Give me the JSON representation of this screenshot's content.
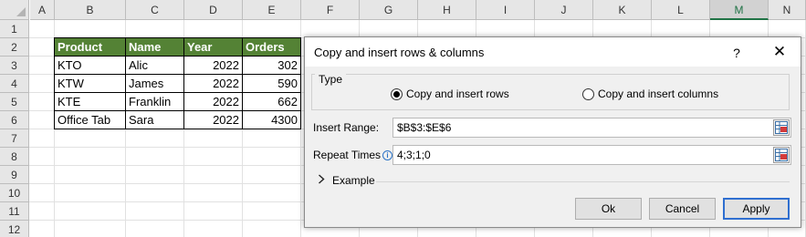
{
  "sheet": {
    "columns": [
      "A",
      "B",
      "C",
      "D",
      "E",
      "F",
      "G",
      "H",
      "I",
      "J",
      "K",
      "L",
      "M",
      "N"
    ],
    "selected_column": "M",
    "rows": [
      "1",
      "2",
      "3",
      "4",
      "5",
      "6",
      "7",
      "8",
      "9",
      "10",
      "11",
      "12"
    ],
    "table": {
      "headers": [
        "Product",
        "Name",
        "Year",
        "Orders"
      ],
      "rows": [
        [
          "KTO",
          "Alic",
          "2022",
          "302"
        ],
        [
          "KTW",
          "James",
          "2022",
          "590"
        ],
        [
          "KTE",
          "Franklin",
          "2022",
          "662"
        ],
        [
          "Office Tab",
          "Sara",
          "2022",
          "4300"
        ]
      ]
    },
    "header_fill_color": "#548235",
    "selection_color": "#217346"
  },
  "dialog": {
    "title": "Copy and insert rows & columns",
    "help_label": "?",
    "close_label": "✕",
    "type_legend": "Type",
    "radio_rows_label": "Copy and insert rows",
    "radio_rows_checked": true,
    "radio_cols_label": "Copy and insert columns",
    "radio_cols_checked": false,
    "insert_range_label": "Insert Range:",
    "insert_range_value": "$B$3:$E$6",
    "repeat_times_label": "Repeat Times",
    "repeat_times_suffix": ":",
    "repeat_times_info_icon": "i",
    "repeat_times_value": "4;3;1;0",
    "example_label": "Example",
    "ok_label": "Ok",
    "cancel_label": "Cancel",
    "apply_label": "Apply",
    "accent_color": "#2f6fd0"
  }
}
